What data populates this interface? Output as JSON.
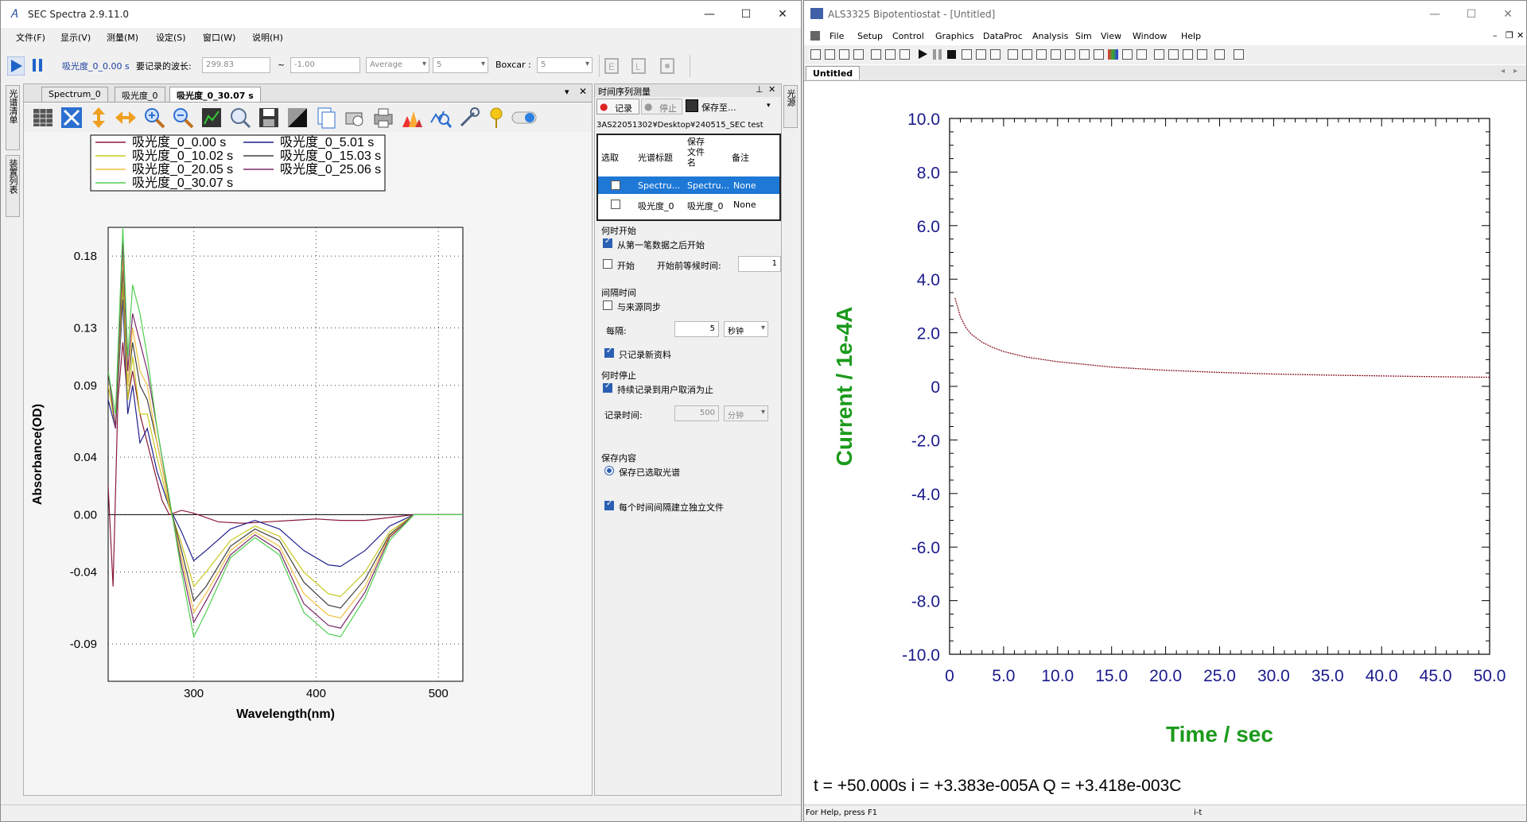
{
  "left_window": {
    "title": "SEC Spectra 2.9.11.0",
    "menu": [
      "文件(F)",
      "显示(V)",
      "测量(M)",
      "设定(S)",
      "窗口(W)",
      "说明(H)"
    ],
    "toolbar": {
      "spectrum_name": "吸光度_0_0.00 s",
      "wavelength_label": "要记录的波长:",
      "wavelength_from": "299.83",
      "tilde": "~",
      "wavelength_to": "-1.00",
      "average_mode": "Average",
      "average_value": "5",
      "boxcar_label": "Boxcar :",
      "boxcar_value": "5"
    },
    "side_tabs": [
      "光谱清单",
      "装置列表"
    ],
    "doc_tabs": [
      "Spectrum_0",
      "吸光度_0",
      "吸光度_0_30.07 s"
    ],
    "chart": {
      "legend": [
        {
          "name": "吸光度_0_0.00 s",
          "color": "#8b1a3a"
        },
        {
          "name": "吸光度_0_5.01 s",
          "color": "#1f1f8c"
        },
        {
          "name": "吸光度_0_10.02 s",
          "color": "#c8c820"
        },
        {
          "name": "吸光度_0_15.03 s",
          "color": "#404040"
        },
        {
          "name": "吸光度_0_20.05 s",
          "color": "#f0c040"
        },
        {
          "name": "吸光度_0_25.06 s",
          "color": "#7a2a6a"
        },
        {
          "name": "吸光度_0_30.07 s",
          "color": "#50d050"
        }
      ],
      "ylabel": "Absorbance(OD)",
      "xlabel": "Wavelength(nm)",
      "yticks": [
        "0.18",
        "0.13",
        "0.09",
        "0.04",
        "0.00",
        "-0.04",
        "-0.09"
      ],
      "xticks": [
        "300",
        "400",
        "500"
      ]
    },
    "ts_panel": {
      "title": "时间序列测量",
      "record_button": "记录",
      "stop_button": "停止",
      "save_button": "保存至...",
      "path": "3AS22051302¥Desktop¥240515_SEC test",
      "columns": [
        "选取",
        "光谱标题",
        "保存文件名",
        "备注"
      ],
      "rows": [
        {
          "title": "Spectru...",
          "file": "Spectru...",
          "note": "None"
        },
        {
          "title": "吸光度_0",
          "file": "吸光度_0",
          "note": "None"
        }
      ],
      "when_start": "何时开始",
      "start_after_first": "从第一笔数据之后开始",
      "start": "开始",
      "wait_before_start": "开始前等候时间:",
      "wait_value": "1",
      "interval": "间隔时间",
      "sync_source": "与来源同步",
      "every": "每隔:",
      "every_value": "5",
      "every_unit": "秒钟",
      "only_new": "只记录新资料",
      "when_stop": "何时停止",
      "until_cancel": "持续记录到用户取消为止",
      "record_time": "记录时间:",
      "record_time_value": "500",
      "record_time_unit": "分钟",
      "save_content": "保存内容",
      "save_selected": "保存已选取光谱",
      "separate_files": "每个时间间隔建立独立文件"
    },
    "right_side_tab": "光源"
  },
  "right_window": {
    "title": "ALS3325 Bipotentiostat - [Untitled]",
    "menu": [
      "File",
      "Setup",
      "Control",
      "Graphics",
      "DataProc",
      "Analysis",
      "Sim",
      "View",
      "Window",
      "Help"
    ],
    "doc_tab": "Untitled",
    "chart": {
      "ylabel": "Current / 1e-4A",
      "xlabel": "Time / sec",
      "yticks": [
        "10.0",
        "8.0",
        "6.0",
        "4.0",
        "2.0",
        "0",
        "-2.0",
        "-4.0",
        "-6.0",
        "-8.0",
        "-10.0"
      ],
      "xticks": [
        "0",
        "5.0",
        "10.0",
        "15.0",
        "20.0",
        "25.0",
        "30.0",
        "35.0",
        "40.0",
        "45.0",
        "50.0"
      ]
    },
    "readout": "t = +50.000s   i = +3.383e-005A   Q = +3.418e-003C",
    "status_left": "For Help, press F1",
    "status_mid": "i-t"
  },
  "chart_data": [
    {
      "type": "line",
      "title": "",
      "xlabel": "Wavelength(nm)",
      "ylabel": "Absorbance(OD)",
      "xlim": [
        230,
        520
      ],
      "ylim": [
        -0.116,
        0.2
      ],
      "series": [
        {
          "name": "吸光度_0_0.00 s",
          "x": [
            230,
            234,
            238,
            242,
            246,
            250,
            256,
            262,
            268,
            274,
            280,
            290,
            300,
            320,
            340,
            360,
            380,
            400,
            420,
            440,
            460,
            480,
            500,
            520
          ],
          "y": [
            0.02,
            -0.05,
            0.08,
            0.12,
            0.08,
            0.1,
            0.07,
            0.05,
            0.03,
            0.01,
            0.0,
            0.003,
            0.001,
            -0.005,
            -0.006,
            -0.005,
            -0.004,
            -0.003,
            -0.004,
            -0.004,
            -0.002,
            0.0,
            0.0,
            0.0
          ]
        },
        {
          "name": "吸光度_0_5.01 s",
          "x": [
            230,
            236,
            242,
            246,
            250,
            256,
            262,
            270,
            280,
            290,
            300,
            310,
            330,
            350,
            370,
            390,
            410,
            420,
            440,
            460,
            480,
            500,
            520
          ],
          "y": [
            0.08,
            0.06,
            0.15,
            0.07,
            0.09,
            0.05,
            0.06,
            0.03,
            0.005,
            -0.012,
            -0.032,
            -0.025,
            -0.01,
            -0.004,
            -0.01,
            -0.025,
            -0.035,
            -0.036,
            -0.025,
            -0.008,
            0.0,
            0.0,
            0.0
          ]
        },
        {
          "name": "吸光度_0_10.02 s",
          "x": [
            230,
            236,
            242,
            246,
            250,
            256,
            262,
            270,
            280,
            290,
            300,
            310,
            330,
            350,
            370,
            390,
            410,
            420,
            440,
            460,
            480,
            500,
            520
          ],
          "y": [
            0.09,
            0.06,
            0.16,
            0.08,
            0.11,
            0.07,
            0.07,
            0.04,
            0.005,
            -0.02,
            -0.05,
            -0.04,
            -0.018,
            -0.008,
            -0.015,
            -0.04,
            -0.055,
            -0.057,
            -0.04,
            -0.012,
            0.0,
            0.0,
            0.0
          ]
        },
        {
          "name": "吸光度_0_15.03 s",
          "x": [
            230,
            236,
            242,
            246,
            250,
            256,
            262,
            270,
            280,
            290,
            300,
            310,
            330,
            350,
            370,
            390,
            410,
            420,
            440,
            460,
            480,
            500,
            520
          ],
          "y": [
            0.1,
            0.06,
            0.17,
            0.09,
            0.12,
            0.09,
            0.08,
            0.05,
            0.008,
            -0.025,
            -0.06,
            -0.05,
            -0.022,
            -0.01,
            -0.018,
            -0.047,
            -0.063,
            -0.065,
            -0.045,
            -0.014,
            0.0,
            0.0,
            0.0
          ]
        },
        {
          "name": "吸光度_0_20.05 s",
          "x": [
            230,
            236,
            242,
            246,
            250,
            256,
            262,
            270,
            280,
            290,
            300,
            310,
            330,
            350,
            370,
            390,
            410,
            420,
            440,
            460,
            480,
            500,
            520
          ],
          "y": [
            0.1,
            0.06,
            0.18,
            0.09,
            0.13,
            0.1,
            0.09,
            0.05,
            0.008,
            -0.03,
            -0.068,
            -0.055,
            -0.025,
            -0.012,
            -0.022,
            -0.055,
            -0.07,
            -0.072,
            -0.05,
            -0.015,
            0.0,
            0.0,
            0.0
          ]
        },
        {
          "name": "吸光度_0_25.06 s",
          "x": [
            230,
            236,
            242,
            246,
            250,
            256,
            262,
            270,
            280,
            290,
            300,
            310,
            330,
            350,
            370,
            390,
            410,
            420,
            440,
            460,
            480,
            500,
            520
          ],
          "y": [
            0.1,
            0.06,
            0.19,
            0.1,
            0.14,
            0.12,
            0.1,
            0.06,
            0.01,
            -0.035,
            -0.075,
            -0.06,
            -0.028,
            -0.014,
            -0.025,
            -0.062,
            -0.077,
            -0.079,
            -0.054,
            -0.016,
            0.0,
            0.0,
            0.0
          ]
        },
        {
          "name": "吸光度_0_30.07 s",
          "x": [
            230,
            236,
            242,
            246,
            250,
            256,
            262,
            270,
            280,
            290,
            300,
            310,
            330,
            350,
            370,
            390,
            410,
            420,
            440,
            460,
            480,
            500,
            520
          ],
          "y": [
            0.1,
            0.07,
            0.2,
            0.11,
            0.16,
            0.14,
            0.11,
            0.06,
            0.012,
            -0.04,
            -0.085,
            -0.068,
            -0.03,
            -0.016,
            -0.028,
            -0.068,
            -0.083,
            -0.085,
            -0.058,
            -0.018,
            0.0,
            0.0,
            0.0
          ]
        }
      ]
    },
    {
      "type": "line",
      "title": "",
      "xlabel": "Time / sec",
      "ylabel": "Current / 1e-4A",
      "xlim": [
        0,
        50
      ],
      "ylim": [
        -10,
        10
      ],
      "series": [
        {
          "x": [
            0.5,
            1,
            1.5,
            2,
            3,
            4,
            5,
            7,
            10,
            15,
            20,
            25,
            30,
            35,
            40,
            45,
            50
          ],
          "y": [
            3.3,
            2.6,
            2.2,
            1.95,
            1.65,
            1.45,
            1.3,
            1.1,
            0.92,
            0.72,
            0.6,
            0.52,
            0.46,
            0.42,
            0.39,
            0.36,
            0.34
          ]
        }
      ]
    }
  ]
}
